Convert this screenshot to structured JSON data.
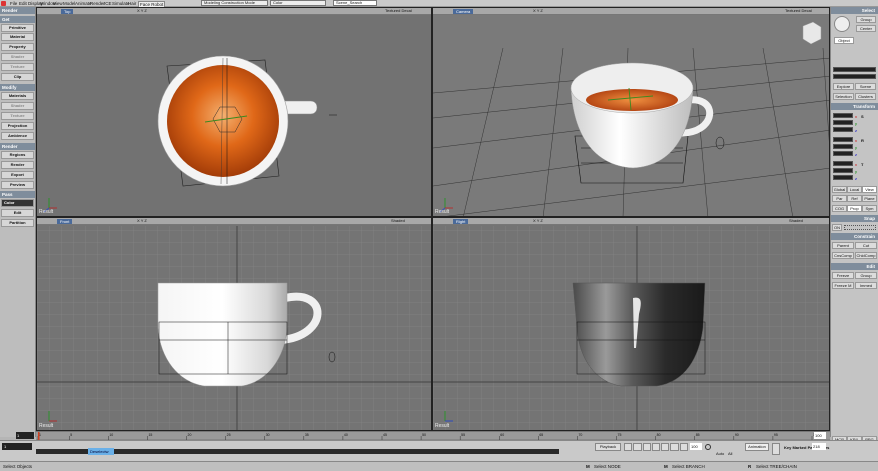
{
  "menubar": {
    "items": [
      "File",
      "Edit",
      "Display",
      "Window",
      "View",
      "Model",
      "Animate",
      "Render",
      "ICE",
      "Simulate",
      "Hair"
    ],
    "face_robot": "Face Robot",
    "mode_combo": "Modeling Construction Mode",
    "color_combo": "Color",
    "scene_search": "Scene_Search"
  },
  "left_toolbar": {
    "sections": {
      "render": "Render",
      "get": "Get",
      "modify": "Modify",
      "render2": "Render",
      "pass": "Pass"
    },
    "get_buttons": [
      "Primitive",
      "Material",
      "Property",
      "Shader",
      "Texture",
      "Clip"
    ],
    "modify_buttons": [
      "Materials",
      "Shader",
      "Texture",
      "Projection",
      "Ambience"
    ],
    "render_buttons": [
      "Regions",
      "Render",
      "Export",
      "Preview"
    ],
    "pass_buttons": [
      "Color",
      "Edit",
      "Partition"
    ]
  },
  "viewports": {
    "top": {
      "name": "Top",
      "mode": "Textured Decal",
      "result": "Result"
    },
    "camera": {
      "name": "Camera",
      "mode": "Textured Decal",
      "result": "Result"
    },
    "front": {
      "name": "Front",
      "mode": "Shaded",
      "result": "Result"
    },
    "right": {
      "name": "Right",
      "mode": "Shaded",
      "result": "Result"
    },
    "xyz": "X Y Z"
  },
  "right_panel": {
    "select": "Select",
    "group": "Group",
    "center": "Center",
    "object": "Object",
    "explore": "Explore",
    "scene": "Scene",
    "selection": "Selection",
    "clusters": "Clusters",
    "transform": "Transform",
    "axis": [
      "S",
      "x",
      "y",
      "z",
      "R",
      "x",
      "y",
      "z",
      "T",
      "x",
      "y",
      "z"
    ],
    "global": "Global",
    "local": "Local",
    "view": "View",
    "par": "Par",
    "ref": "Ref",
    "plane": "Plane",
    "cog": "COG",
    "prop": "Prop",
    "sym": "Sym",
    "snap": "Snap",
    "on": "ON",
    "constrain": "Constrain",
    "parent": "Parent",
    "cut": "Cut",
    "cnscomp": "CnsComp",
    "chldcomp": "ChldComp",
    "edit": "Edit",
    "freeze": "Freeze",
    "group2": "Group",
    "freeze_m": "Freeze M",
    "immed": "Immed",
    "bottom_tabs": [
      "MCP",
      "KP/L",
      "PPG"
    ]
  },
  "timeline": {
    "start": "1",
    "end": "100",
    "current": "1",
    "ticks": [
      "1",
      "5",
      "10",
      "15",
      "20",
      "25",
      "30",
      "35",
      "40",
      "45",
      "50",
      "55",
      "60",
      "65",
      "70",
      "75",
      "80",
      "85",
      "90",
      "95",
      "100"
    ],
    "end_field": "100",
    "end_field2": "218"
  },
  "anim": {
    "frame_field": "1",
    "layer": "Deselectw",
    "playback": "Playback",
    "auto": "Auto",
    "all": "All",
    "frame_end": "100",
    "animation": "Animation",
    "key_marked": "Key Marked Parameters"
  },
  "status": {
    "left": "Select Objects",
    "m": "M",
    "select_node": "Select NODE",
    "select_branch": "Select BRANCH",
    "r": "R",
    "select_tree": "Select TREE/CHAIN"
  },
  "colors": {
    "viewport_bg": "#6f6f6f",
    "panel_header": "#7f8d9c",
    "tea": "#e07020",
    "timeline_cursor": "#d04020"
  }
}
